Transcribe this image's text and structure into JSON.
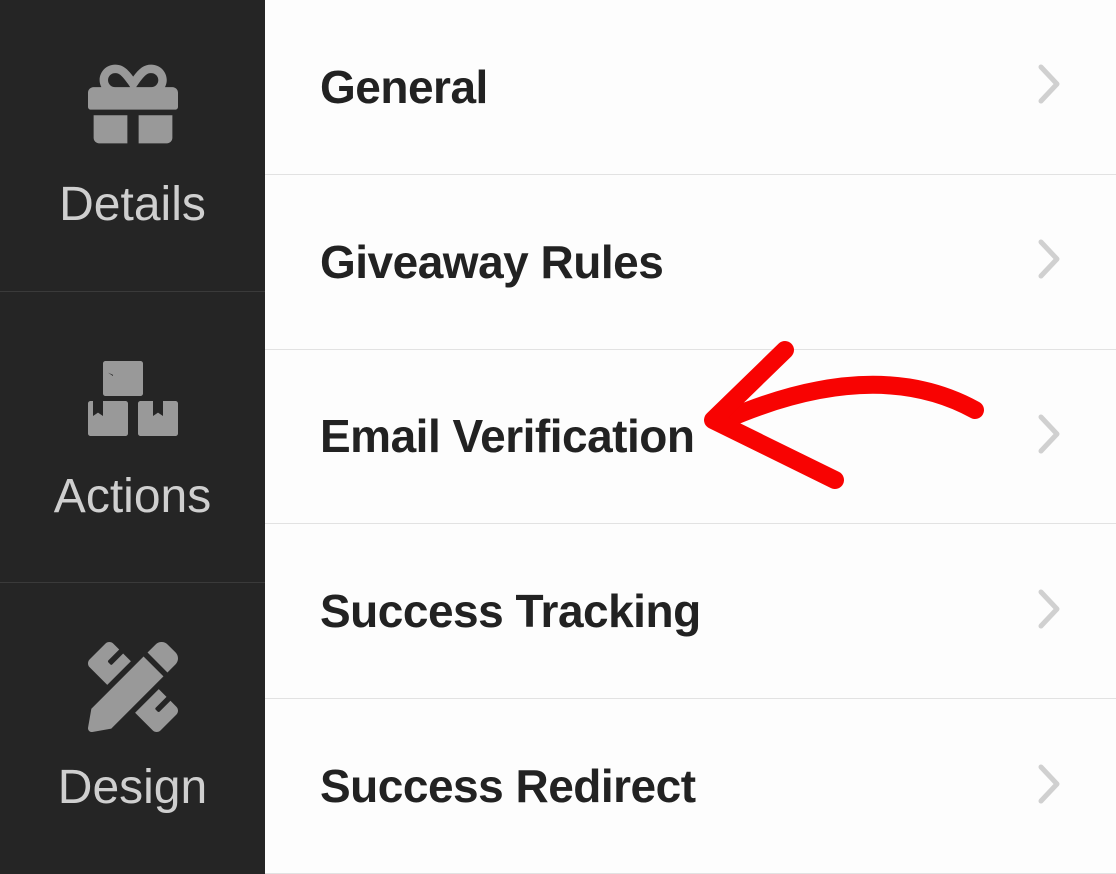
{
  "sidebar": {
    "items": [
      {
        "label": "Details",
        "icon": "gift-icon"
      },
      {
        "label": "Actions",
        "icon": "boxes-icon"
      },
      {
        "label": "Design",
        "icon": "pencil-ruler-icon"
      }
    ]
  },
  "menu": {
    "items": [
      {
        "label": "General"
      },
      {
        "label": "Giveaway Rules"
      },
      {
        "label": "Email Verification"
      },
      {
        "label": "Success Tracking"
      },
      {
        "label": "Success Redirect"
      }
    ]
  },
  "annotation": {
    "type": "arrow",
    "color": "#f80302",
    "points_to": "menu-item-email-verification"
  }
}
